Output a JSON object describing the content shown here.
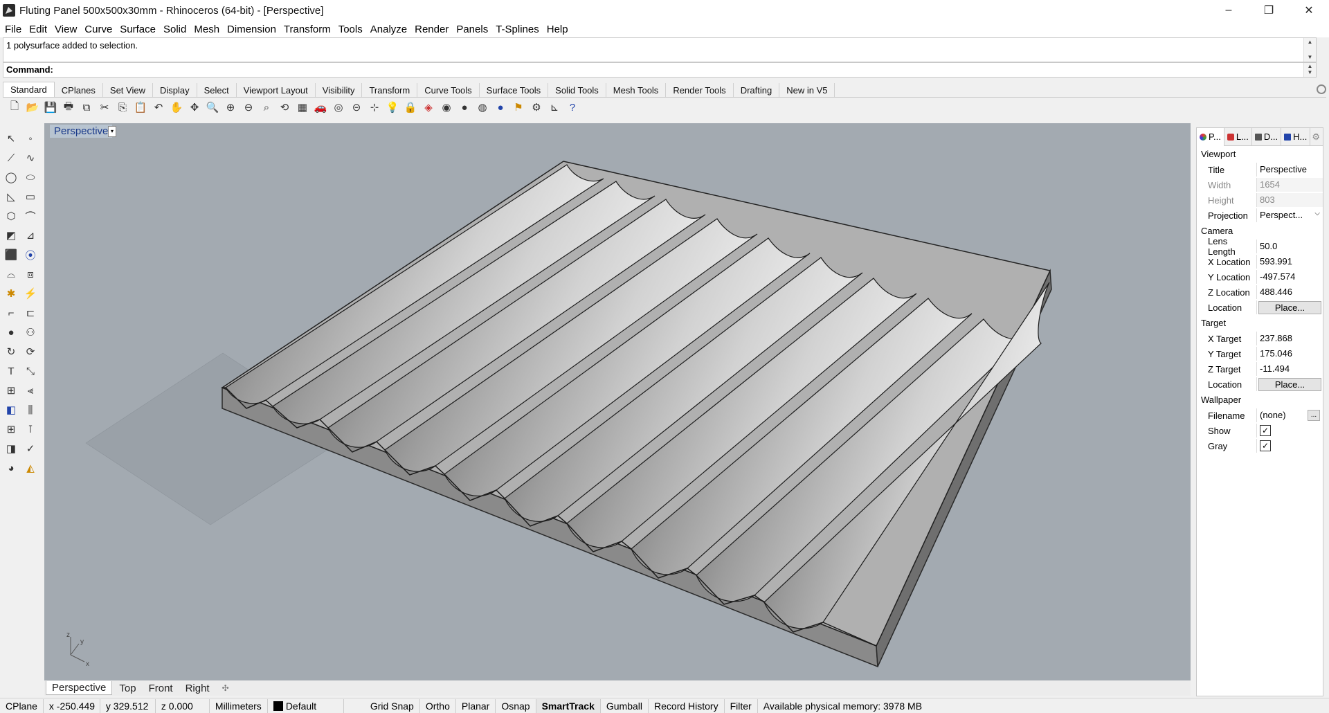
{
  "window": {
    "title": "Fluting Panel 500x500x30mm - Rhinoceros (64-bit) - [Perspective]",
    "min_icon": "–",
    "max_icon": "❐",
    "close_icon": "✕"
  },
  "menu": [
    "File",
    "Edit",
    "View",
    "Curve",
    "Surface",
    "Solid",
    "Mesh",
    "Dimension",
    "Transform",
    "Tools",
    "Analyze",
    "Render",
    "Panels",
    "T-Splines",
    "Help"
  ],
  "command": {
    "history": "1 polysurface added to selection.",
    "prompt": "Command:"
  },
  "tabs": [
    "Standard",
    "CPlanes",
    "Set View",
    "Display",
    "Select",
    "Viewport Layout",
    "Visibility",
    "Transform",
    "Curve Tools",
    "Surface Tools",
    "Solid Tools",
    "Mesh Tools",
    "Render Tools",
    "Drafting",
    "New in V5"
  ],
  "toolbar_icons": [
    "new-icon",
    "open-icon",
    "save-icon",
    "print-icon",
    "import-icon",
    "cut-icon",
    "copy-icon",
    "paste-icon",
    "undo-icon",
    "pan-icon",
    "move-icon",
    "zoom-icon",
    "zoom-window-icon",
    "zoom-extents-icon",
    "zoom-selected-icon",
    "rotate-view-icon",
    "four-view-icon",
    "car-icon",
    "camera-icon",
    "cplane-icon",
    "snap-icon",
    "light-icon",
    "lock-icon",
    "layer-icon",
    "color-icon",
    "shaded-icon",
    "rendered-icon",
    "render-icon",
    "lamp-icon",
    "options-icon",
    "gumball-icon",
    "help-icon"
  ],
  "viewport": {
    "title": "Perspective",
    "dropdown": "▾",
    "axes": {
      "x": "x",
      "y": "y",
      "z": "z"
    },
    "tabs": [
      "Perspective",
      "Top",
      "Front",
      "Right"
    ],
    "add_tab": "✣"
  },
  "panel": {
    "tabs": [
      "P...",
      "L...",
      "D...",
      "H..."
    ],
    "viewport_label": "Viewport",
    "title_k": "Title",
    "title_v": "Perspective",
    "width_k": "Width",
    "width_v": "1654",
    "height_k": "Height",
    "height_v": "803",
    "projection_k": "Projection",
    "projection_v": "Perspect...",
    "camera_label": "Camera",
    "lens_k": "Lens Length",
    "lens_v": "50.0",
    "xloc_k": "X Location",
    "xloc_v": "593.991",
    "yloc_k": "Y Location",
    "yloc_v": "-497.574",
    "zloc_k": "Z Location",
    "zloc_v": "488.446",
    "loc_k": "Location",
    "place_btn": "Place...",
    "target_label": "Target",
    "xt_k": "X Target",
    "xt_v": "237.868",
    "yt_k": "Y Target",
    "yt_v": "175.046",
    "zt_k": "Z Target",
    "zt_v": "-11.494",
    "wallpaper_label": "Wallpaper",
    "file_k": "Filename",
    "file_v": "(none)",
    "file_btn": "...",
    "show_k": "Show",
    "gray_k": "Gray",
    "check": "✓"
  },
  "status": {
    "cplane": "CPlane",
    "x": "x -250.449",
    "y": "y 329.512",
    "z": "z 0.000",
    "units": "Millimeters",
    "layer": "Default",
    "grid_snap": "Grid Snap",
    "ortho": "Ortho",
    "planar": "Planar",
    "osnap": "Osnap",
    "smarttrack": "SmartTrack",
    "gumball": "Gumball",
    "record_history": "Record History",
    "filter": "Filter",
    "memory": "Available physical memory: 3978 MB"
  },
  "colors": {
    "viewport_bg": "#a3aab1",
    "panel_bg": "#888888"
  }
}
